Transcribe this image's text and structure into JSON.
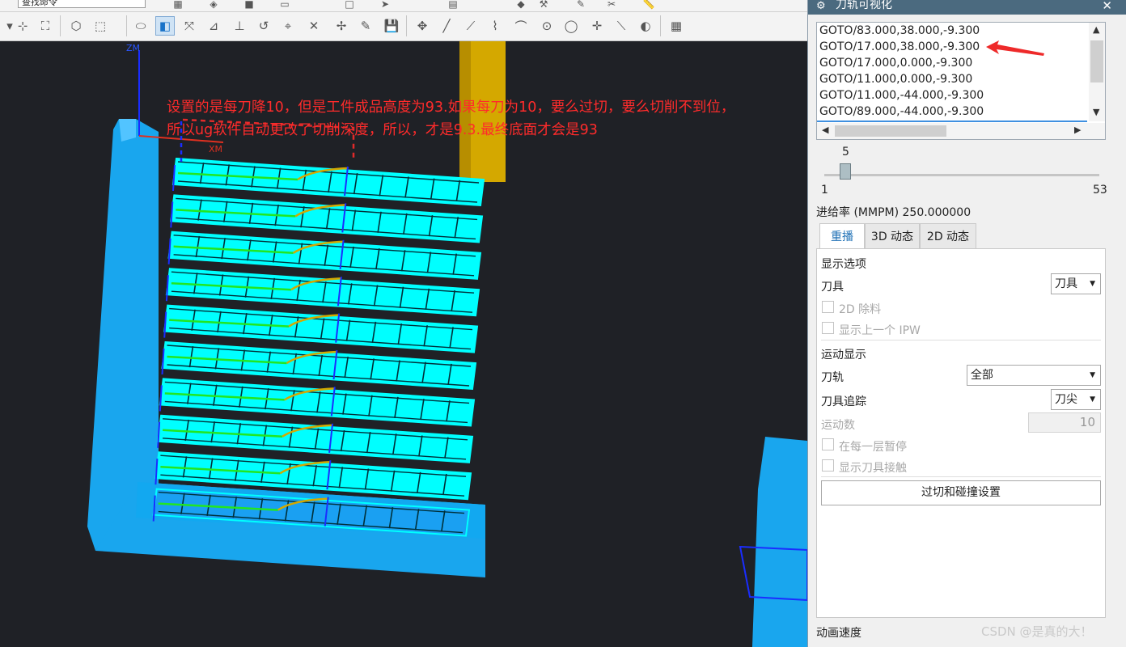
{
  "toolbar": {
    "command_finder_label": "查找命令"
  },
  "viewport": {
    "axis_z_label": "ZM",
    "axis_x_label": "XM",
    "annotation_line1": "设置的是每刀降10，但是工件成品高度为93.如果每刀为10，要么过切，要么切削不到位，",
    "annotation_line2": "所以ug软件自动更改了切削深度，所以，才是9.3.最终底面才会是93",
    "colors": {
      "background": "#1f2126",
      "workpiece": "#19a6ee",
      "toolpath_cyan": "#00ffff",
      "path_green": "#22e622",
      "path_blue": "#1a2dff",
      "tool_gold": "#d4a800",
      "annotation": "#ff2b2b"
    }
  },
  "dialog": {
    "title": "刀轨可视化",
    "close_label": "✕",
    "path_lines": [
      "GOTO/83.000,38.000,-9.300",
      "GOTO/17.000,38.000,-9.300",
      "GOTO/17.000,0.000,-9.300",
      "GOTO/11.000,0.000,-9.300",
      "GOTO/11.000,-44.000,-9.300",
      "GOTO/89.000,-44.000,-9.300"
    ],
    "selected_line_index": 1,
    "slider": {
      "value": "5",
      "min": "1",
      "max": "53",
      "fraction": 0.077
    },
    "feed_rate_label": "进给率 (MMPM) 250.000000",
    "tabs": [
      "重播",
      "3D 动态",
      "2D 动态"
    ],
    "active_tab": 0,
    "display_options_header": "显示选项",
    "tool_label": "刀具",
    "tool_value": "刀具",
    "remove_2d_label": "2D 除料",
    "show_prev_ipw_label": "显示上一个 IPW",
    "motion_display_header": "运动显示",
    "path_label": "刀轨",
    "path_value": "全部",
    "tool_trace_label": "刀具追踪",
    "tool_trace_value": "刀尖",
    "motion_count_label": "运动数",
    "motion_count_value": "10",
    "pause_each_layer_label": "在每一层暂停",
    "show_tool_contact_label": "显示刀具接触",
    "gouge_button_label": "过切和碰撞设置",
    "anim_speed_label": "动画速度"
  },
  "watermark": "CSDN @是真的大！"
}
